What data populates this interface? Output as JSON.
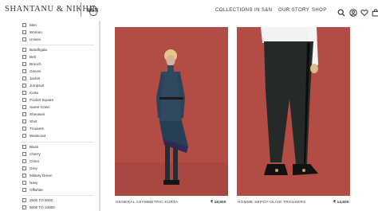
{
  "header": {
    "brand": "SHANTANU & NIKHIL",
    "monogram": "S&N",
    "nav": [
      "COLLECTIONS",
      "IN S&N",
      "OUR STORY",
      "SHOP"
    ]
  },
  "icons": {
    "search": "search-icon",
    "account": "user-icon",
    "wishlist": "heart-icon",
    "cart": "bag-icon"
  },
  "filters": {
    "gender": [
      "Men",
      "Women",
      "Unisex"
    ],
    "category": [
      "Bandhgala",
      "Belt",
      "Brooch",
      "Gloves",
      "Jacket",
      "Jumpsuit",
      "Kurta",
      "Pocket Square",
      "Saree Gown",
      "Sherwani",
      "Shirt",
      "Trousers",
      "Waistcoat"
    ],
    "color": [
      "Black",
      "Cherry",
      "Chino",
      "Grey",
      "Military Green",
      "Navy",
      "Offwhite"
    ],
    "price": [
      "2500 TO 5000",
      "5000 TO 10000"
    ]
  },
  "products": [
    {
      "name": "GENERAL ASYMMETRIC KURTA",
      "price": "₹ 18,500"
    },
    {
      "name": "HOMME SEPOY OLIVE TROUSERS",
      "price": "₹ 14,500"
    }
  ],
  "colors": {
    "product_bg": "#b24c44",
    "sidebar_rule": "#d9d9d9"
  }
}
